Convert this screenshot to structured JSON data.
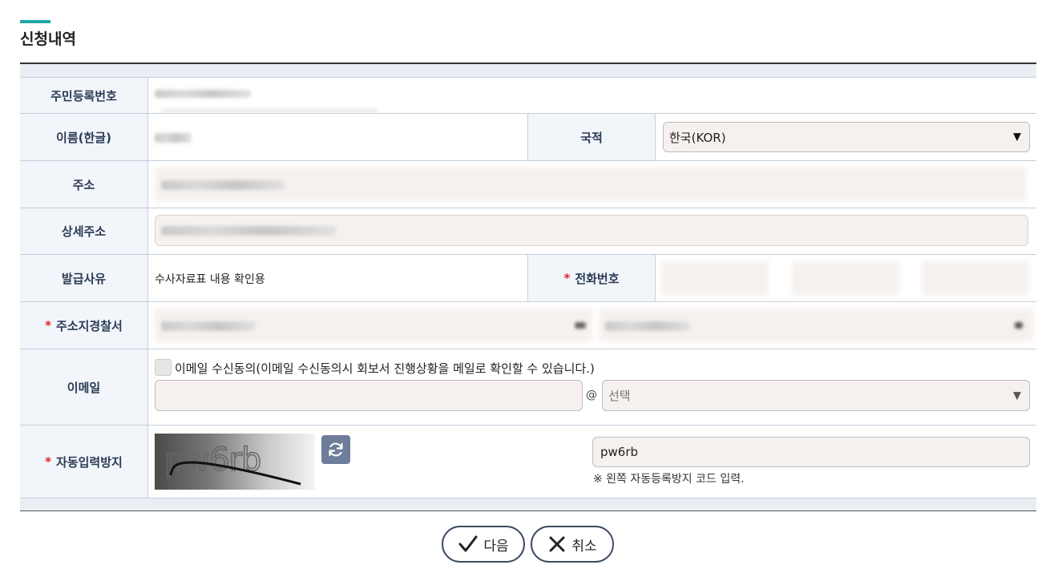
{
  "section": {
    "title": "신청내역"
  },
  "fields": {
    "resident_number_label": "주민등록번호",
    "name_label": "이름(한글)",
    "nationality_label": "국적",
    "nationality_value": "한국(KOR)",
    "address_label": "주소",
    "detail_address_label": "상세주소",
    "reason_label": "발급사유",
    "reason_value": "수사자료표 내용 확인용",
    "phone_label": "전화번호",
    "police_label": "주소지경찰서",
    "email_label": "이메일",
    "email_consent_text": "이메일 수신동의(이메일 수신동의시 회보서 진행상황을 메일로 확인할 수 있습니다.)",
    "email_at": "@",
    "email_domain_placeholder": "선택",
    "captcha_label": "자동입력방지",
    "captcha_image_text": "pw6rb",
    "captcha_input_value": "pw6rb",
    "captcha_hint": "※ 왼쪽 자동등록방지 코드 입력.",
    "required_mark": "*"
  },
  "buttons": {
    "next_label": "다음",
    "cancel_label": "취소"
  },
  "icons": {
    "select_arrow": "▼",
    "refresh": "refresh-icon",
    "check": "check-icon",
    "close": "close-icon"
  },
  "colors": {
    "accent": "#1fa9a3",
    "label_bg": "#f2f5f9",
    "label_text": "#2a3b55",
    "required": "#dd2222",
    "input_bg": "#f6f1ee",
    "button_border": "#3b4b63",
    "refresh_bg": "#6e7d99"
  }
}
